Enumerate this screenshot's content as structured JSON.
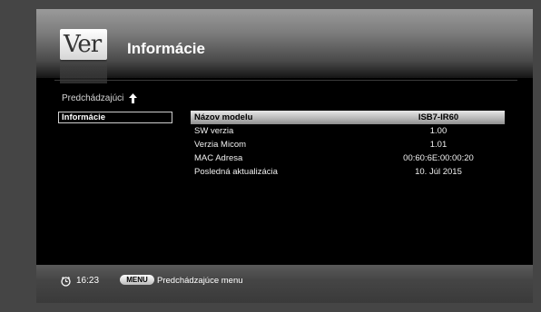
{
  "header": {
    "logo_text": "Ver",
    "title": "Informácie"
  },
  "nav": {
    "back_label": "Predchádzajúci",
    "current_item": "Informácie"
  },
  "info_rows": [
    {
      "label": "Názov modelu",
      "value": "ISB7-IR60",
      "selected": true
    },
    {
      "label": "SW verzia",
      "value": "1.00"
    },
    {
      "label": "Verzia Micom",
      "value": "1.01"
    },
    {
      "label": "MAC Adresa",
      "value": "00:60:6E:00:00:20"
    },
    {
      "label": "Posledná aktualizácia",
      "value": "10. Júl 2015"
    }
  ],
  "footer": {
    "time": "16:23",
    "menu_key": "MENU",
    "menu_label": "Predchádzajúce menu"
  },
  "colors": {
    "background": "#000000",
    "selection": "#c8c8c8",
    "frame": "#454545"
  }
}
